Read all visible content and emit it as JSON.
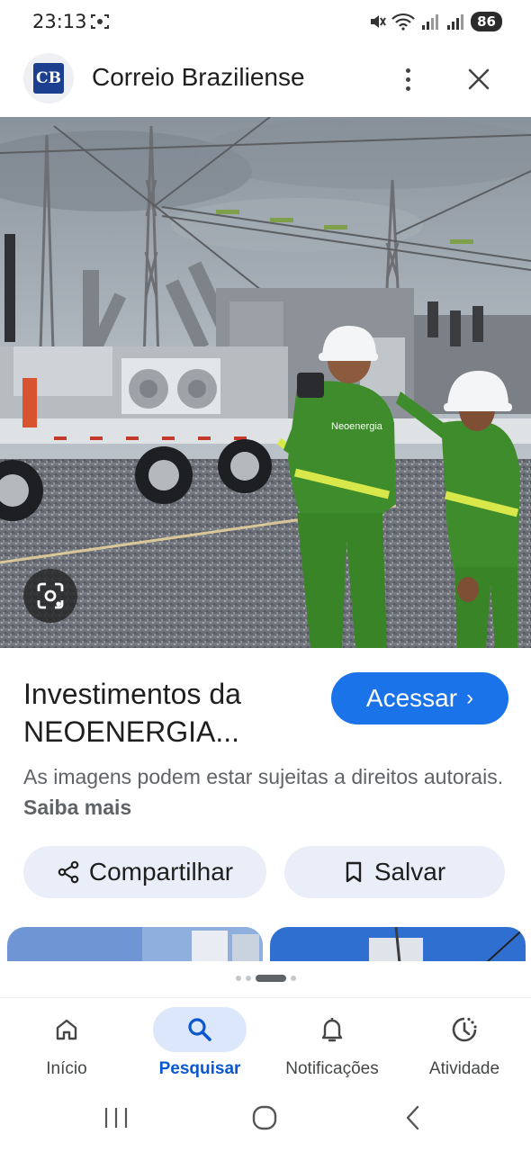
{
  "status_bar": {
    "time": "23:13",
    "battery": "86"
  },
  "header": {
    "logo_text": "CB",
    "site_name": "Correio Braziliense"
  },
  "hero": {
    "vest_text": "Neoenergia"
  },
  "result": {
    "title_line1": "Investimentos da",
    "title_line2": "NEOENERGIA...",
    "visit_label": "Acessar",
    "copyright_text": "As imagens podem estar sujeitas a direitos autorais.",
    "learn_more": "Saiba mais"
  },
  "actions": {
    "share_label": "Compartilhar",
    "save_label": "Salvar"
  },
  "bottom_nav": {
    "items": [
      {
        "label": "Início",
        "icon": "home-icon"
      },
      {
        "label": "Pesquisar",
        "icon": "search-icon"
      },
      {
        "label": "Notificações",
        "icon": "bell-icon"
      },
      {
        "label": "Atividade",
        "icon": "activity-icon"
      }
    ],
    "active": "Pesquisar"
  },
  "colors": {
    "accent": "#1a73e8",
    "chip_bg": "#e9eef8",
    "nav_active_bg": "#dde7fb",
    "nav_active_text": "#0b57d0"
  }
}
